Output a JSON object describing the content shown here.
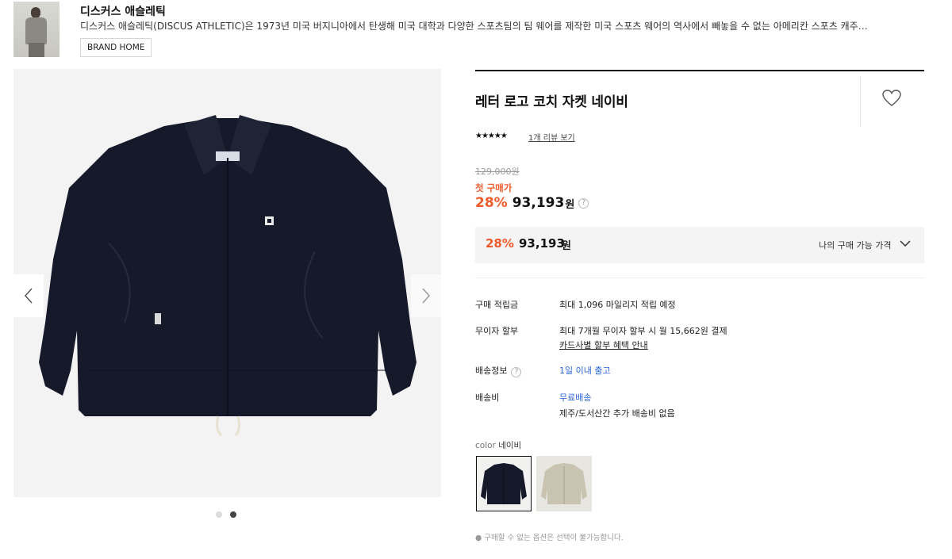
{
  "brand": {
    "name": "디스커스 애슬레틱",
    "description": "디스커스 애슬레틱(DISCUS ATHLETIC)은 1973년 미국 버지니아에서 탄생해 미국 대학과 다양한 스포츠팀의 팀 웨어를 제작한 미국 스포츠 웨어의 역사에서 빼놓을 수 없는 아메리칸 스포츠 캐주얼 브랜...",
    "home_button": "BRAND HOME"
  },
  "gallery": {
    "current_index": 2,
    "total": 2,
    "prev_icon": "chevron-left-icon",
    "next_icon": "chevron-right-icon"
  },
  "product": {
    "title": "레터 로고 코치 자켓 네이비",
    "rating_stars": "★★★★★",
    "rating": 5,
    "review_link": "1개 리뷰 보기",
    "original_price": "129,000원",
    "first_buy_label": "첫 구매가",
    "discount": "28%",
    "price": "93,193",
    "currency": "원"
  },
  "my_price": {
    "discount": "28%",
    "price": "93,193",
    "currency": "원",
    "label": "나의 구매 가능 가격"
  },
  "info": [
    {
      "label": "구매 적립금",
      "value": "최대 1,096 마일리지 적립 예정"
    },
    {
      "label": "무이자 할부",
      "value": "최대 7개월 무이자 할부 시 월 15,662원 결제",
      "link": "카드사별 할부 혜택 안내"
    },
    {
      "label": "배송정보",
      "value": "1일 이내 출고"
    },
    {
      "label": "배송비",
      "value": "무료배송",
      "sub": "제주/도서산간 추가 배송비 없음"
    }
  ],
  "colors": {
    "label": "color",
    "selected": "네이비",
    "options": [
      "네이비",
      "베이지"
    ]
  },
  "note": "● 구매할 수 없는 옵션은 선택이 불가능합니다.",
  "palette": {
    "accent": "#ef5a2b",
    "link_blue": "#2a64d8",
    "jacket_navy": "#15192a",
    "jacket_beige": "#c9c3b1"
  }
}
